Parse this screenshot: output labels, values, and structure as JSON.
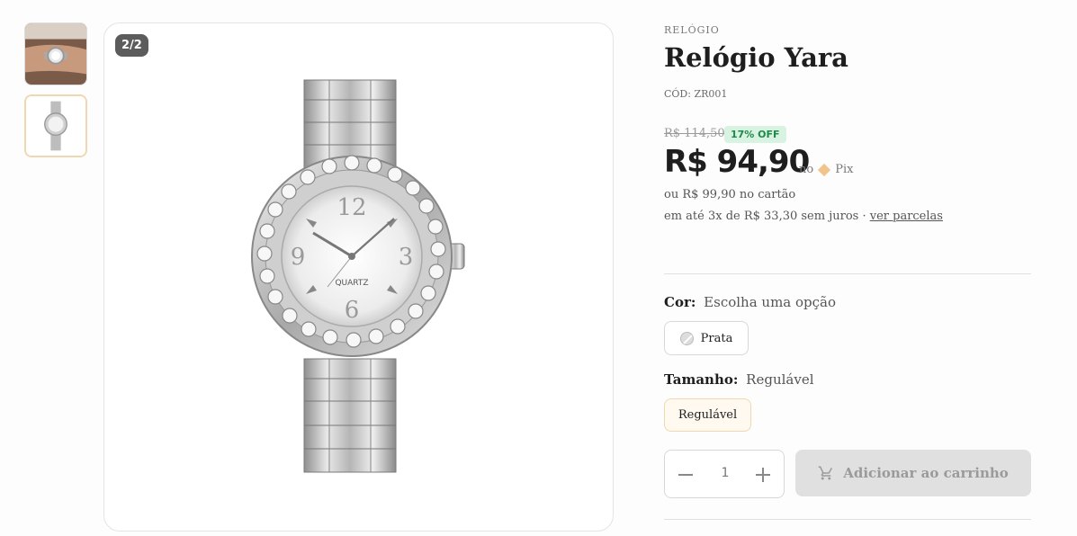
{
  "gallery": {
    "counter": "2/2",
    "thumbnails": [
      {
        "alt": "watch on wrist"
      },
      {
        "alt": "watch front"
      }
    ]
  },
  "product": {
    "category": "RELÓGIO",
    "title": "Relógio Yara",
    "sku": "CÓD: ZR001",
    "old_price": "R$ 114,50",
    "discount_badge": "17% OFF",
    "price": "R$ 94,90",
    "pix_prefix": "no",
    "pix_label": "Pix",
    "card_price_line": "ou R$ 99,90 no cartão",
    "installments_text": "em até 3x de R$ 33,30 sem juros ·",
    "installments_link": "ver parcelas"
  },
  "options": {
    "color": {
      "label": "Cor:",
      "value": "Escolha uma opção",
      "choices": [
        "Prata"
      ]
    },
    "size": {
      "label": "Tamanho:",
      "value": "Regulável",
      "choices": [
        "Regulável"
      ]
    }
  },
  "cart": {
    "quantity": "1",
    "add_button": "Adicionar ao carrinho"
  },
  "watch_face": {
    "brand_text": "QUARTZ",
    "numerals": [
      "12",
      "3",
      "6",
      "9"
    ]
  },
  "colors": {
    "discount_bg": "#d8f3e2",
    "discount_text": "#1e8a48",
    "selected_border": "#f0d7b0",
    "button_disabled_bg": "#e0e0e0"
  }
}
